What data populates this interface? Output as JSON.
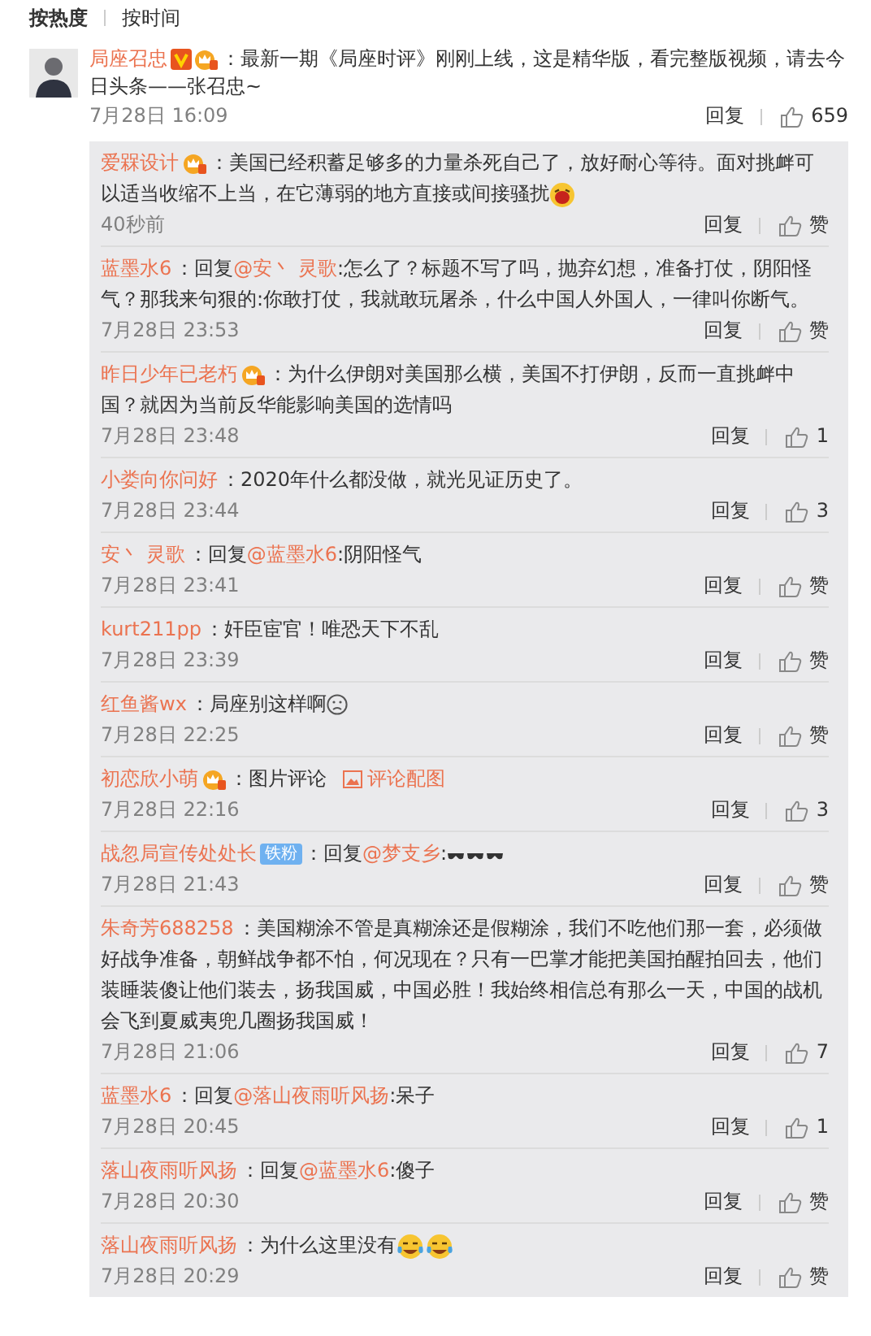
{
  "sort_tabs": [
    {
      "label": "按热度",
      "selected": true
    },
    {
      "label": "按时间",
      "selected": false
    }
  ],
  "comment": {
    "author": "局座召忠",
    "badges": [
      {
        "kind": "verified"
      },
      {
        "kind": "member"
      }
    ],
    "text": "：最新一期《局座时评》刚刚上线，这是精华版，看完整版视频，请去今日头条——张召忠~",
    "time": "7月28日 16:09",
    "reply_label": "回复",
    "likes": "659"
  },
  "replies": [
    {
      "author": "爱槑设计",
      "badges": [
        {
          "kind": "member"
        }
      ],
      "parts": [
        {
          "kind": "text",
          "text": "：美国已经积蓄足够多的力量杀死自己了，放好耐心等待。面对挑衅可以适当收缩不上当，在它薄弱的地方直接或间接骚扰"
        },
        {
          "kind": "laughing_emoji"
        }
      ],
      "time": "40秒前",
      "reply_label": "回复",
      "likes": "赞"
    },
    {
      "author": "蓝墨水6",
      "parts": [
        {
          "kind": "text",
          "text": "：回复"
        },
        {
          "kind": "mention",
          "text": "@安丶 灵歌"
        },
        {
          "kind": "text",
          "text": ":怎么了？标题不写了吗，抛弃幻想，准备打仗，阴阳怪气？那我来句狠的:你敢打仗，我就敢玩屠杀，什么中国人外国人，一律叫你断气。"
        }
      ],
      "time": "7月28日 23:53",
      "reply_label": "回复",
      "likes": "赞"
    },
    {
      "author": "昨日少年已老朽",
      "badges": [
        {
          "kind": "member"
        }
      ],
      "parts": [
        {
          "kind": "text",
          "text": "：为什么伊朗对美国那么横，美国不打伊朗，反而一直挑衅中国？就因为当前反华能影响美国的选情吗"
        }
      ],
      "time": "7月28日 23:48",
      "reply_label": "回复",
      "likes": "1"
    },
    {
      "author": "小娄向你问好",
      "parts": [
        {
          "kind": "text",
          "text": "：2020年什么都没做，就光见证历史了。"
        }
      ],
      "time": "7月28日 23:44",
      "reply_label": "回复",
      "likes": "3"
    },
    {
      "author": "安丶 灵歌",
      "parts": [
        {
          "kind": "text",
          "text": "：回复"
        },
        {
          "kind": "mention",
          "text": "@蓝墨水6"
        },
        {
          "kind": "text",
          "text": ":阴阳怪气"
        }
      ],
      "time": "7月28日 23:41",
      "reply_label": "回复",
      "likes": "赞"
    },
    {
      "author": "kurt211pp",
      "parts": [
        {
          "kind": "text",
          "text": "：奸臣宦官！唯恐天下不乱"
        }
      ],
      "time": "7月28日 23:39",
      "reply_label": "回复",
      "likes": "赞"
    },
    {
      "author": "红鱼酱wx",
      "parts": [
        {
          "kind": "text",
          "text": "：局座别这样啊"
        },
        {
          "kind": "sad_emoji"
        }
      ],
      "time": "7月28日 22:25",
      "reply_label": "回复",
      "likes": "赞"
    },
    {
      "author": "初恋欣小萌",
      "badges": [
        {
          "kind": "member"
        }
      ],
      "parts": [
        {
          "kind": "text",
          "text": "：图片评论"
        },
        {
          "kind": "picture_link",
          "text": "评论配图"
        }
      ],
      "time": "7月28日 22:16",
      "reply_label": "回复",
      "likes": "3"
    },
    {
      "author": "战忽局宣传处处长",
      "badges": [
        {
          "kind": "iron_fan",
          "label": "铁粉"
        }
      ],
      "parts": [
        {
          "kind": "text",
          "text": "：回复"
        },
        {
          "kind": "mention",
          "text": "@梦支乡"
        },
        {
          "kind": "text",
          "text": ":"
        },
        {
          "kind": "sunglasses_emoji"
        },
        {
          "kind": "sunglasses_emoji"
        },
        {
          "kind": "sunglasses_emoji"
        }
      ],
      "time": "7月28日 21:43",
      "reply_label": "回复",
      "likes": "赞"
    },
    {
      "author": "朱奇芳688258",
      "parts": [
        {
          "kind": "text",
          "text": "：美国糊涂不管是真糊涂还是假糊涂，我们不吃他们那一套，必须做好战争准备，朝鲜战争都不怕，何况现在？只有一巴掌才能把美国拍醒拍回去，他们装睡装傻让他们装去，扬我国威，中国必胜！我始终相信总有那么一天，中国的战机会飞到夏威夷兜几圈扬我国威！"
        }
      ],
      "time": "7月28日 21:06",
      "reply_label": "回复",
      "likes": "7"
    },
    {
      "author": "蓝墨水6",
      "parts": [
        {
          "kind": "text",
          "text": "：回复"
        },
        {
          "kind": "mention",
          "text": "@落山夜雨听风扬"
        },
        {
          "kind": "text",
          "text": ":呆子"
        }
      ],
      "time": "7月28日 20:45",
      "reply_label": "回复",
      "likes": "1"
    },
    {
      "author": "落山夜雨听风扬",
      "parts": [
        {
          "kind": "text",
          "text": "：回复"
        },
        {
          "kind": "mention",
          "text": "@蓝墨水6"
        },
        {
          "kind": "text",
          "text": ":傻子"
        }
      ],
      "time": "7月28日 20:30",
      "reply_label": "回复",
      "likes": "赞"
    },
    {
      "author": "落山夜雨听风扬",
      "parts": [
        {
          "kind": "text",
          "text": "：为什么这里没有"
        },
        {
          "kind": "tears_of_joy_emoji"
        },
        {
          "kind": "tears_of_joy_emoji"
        }
      ],
      "time": "7月28日 20:29",
      "reply_label": "回复",
      "likes": "赞"
    }
  ]
}
